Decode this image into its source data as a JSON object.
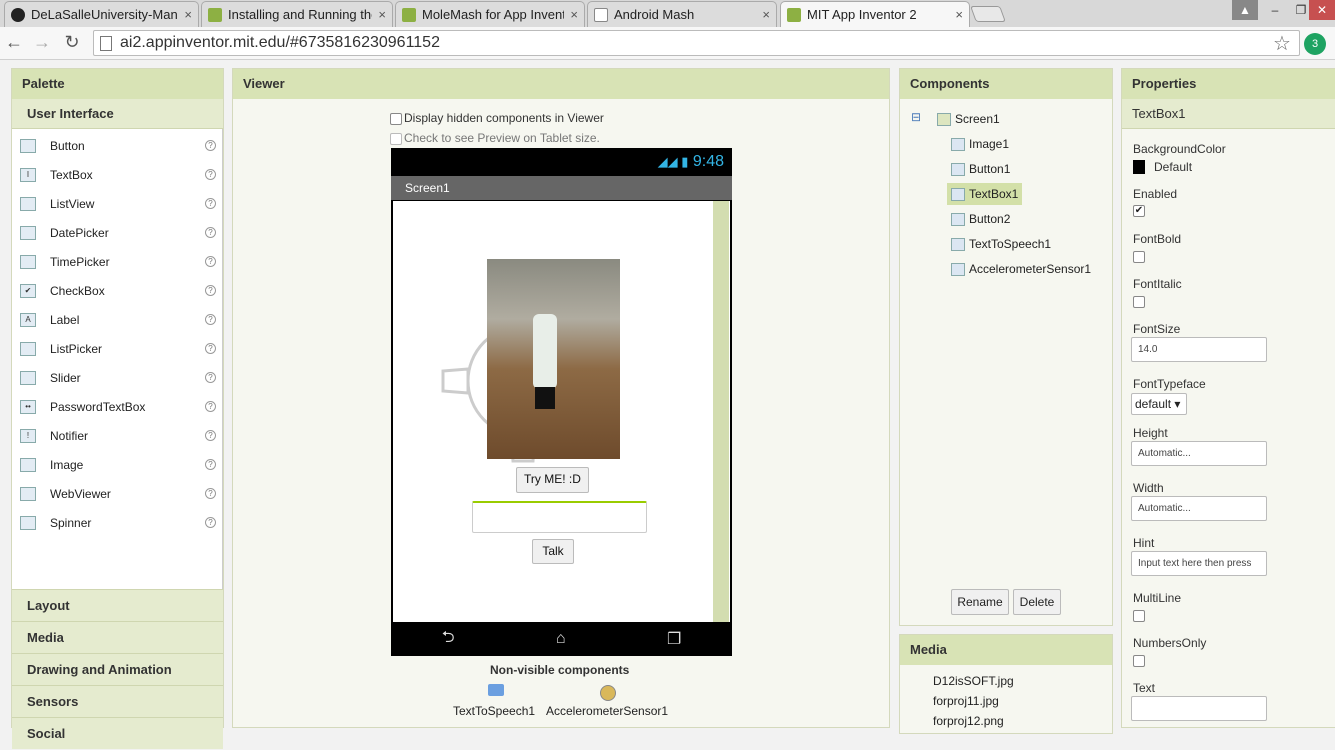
{
  "browser": {
    "tabs": [
      {
        "title": "DeLaSalleUniversity-Manil",
        "icon": "github-icon"
      },
      {
        "title": "Installing and Running the",
        "icon": "app-inventor-icon"
      },
      {
        "title": "MoleMash for App Invento",
        "icon": "app-inventor-icon"
      },
      {
        "title": "Android Mash",
        "icon": "page-icon"
      },
      {
        "title": "MIT App Inventor 2",
        "icon": "app-inventor-icon"
      }
    ],
    "close_glyph": "×",
    "url": "ai2.appinventor.mit.edu/#6735816230961152",
    "extension_badge": "3"
  },
  "palette": {
    "title": "Palette",
    "open_category": "User Interface",
    "items": [
      "Button",
      "TextBox",
      "ListView",
      "DatePicker",
      "TimePicker",
      "CheckBox",
      "Label",
      "ListPicker",
      "Slider",
      "PasswordTextBox",
      "Notifier",
      "Image",
      "WebViewer",
      "Spinner"
    ],
    "item_icons": [
      "",
      "I",
      "",
      "",
      "",
      "✔",
      "A",
      "",
      "",
      "••",
      "!",
      "",
      "",
      ""
    ],
    "help_glyph": "?",
    "categories": [
      "Layout",
      "Media",
      "Drawing and Animation",
      "Sensors",
      "Social"
    ]
  },
  "viewer": {
    "title": "Viewer",
    "hidden_label": "Display hidden components in Viewer",
    "tablet_label": "Check to see Preview on Tablet size.",
    "clock": "9:48",
    "screen_title": "Screen1",
    "button1": "Try ME! :D",
    "button2": "Talk",
    "nonvisible_title": "Non-visible components",
    "nonvisible": [
      "TextToSpeech1",
      "AccelerometerSensor1"
    ]
  },
  "components": {
    "title": "Components",
    "collapse_glyph": "⊟",
    "root": "Screen1",
    "children": [
      "Image1",
      "Button1",
      "TextBox1",
      "Button2",
      "TextToSpeech1",
      "AccelerometerSensor1"
    ],
    "selected": "TextBox1",
    "rename": "Rename",
    "delete": "Delete"
  },
  "media": {
    "title": "Media",
    "files": [
      "D12isSOFT.jpg",
      "forproj11.jpg",
      "forproj12.png"
    ]
  },
  "properties": {
    "title": "Properties",
    "component": "TextBox1",
    "background_label": "BackgroundColor",
    "background_value": "Default",
    "enabled_label": "Enabled",
    "enabled_mark": "✔",
    "fontbold_label": "FontBold",
    "fontitalic_label": "FontItalic",
    "fontsize_label": "FontSize",
    "fontsize_value": "14.0",
    "fonttypeface_label": "FontTypeface",
    "fonttypeface_value": "default ▾",
    "height_label": "Height",
    "height_value": "Automatic...",
    "width_label": "Width",
    "width_value": "Automatic...",
    "hint_label": "Hint",
    "hint_value": "Input text here then press",
    "multiline_label": "MultiLine",
    "numbersonly_label": "NumbersOnly",
    "text_label": "Text"
  }
}
